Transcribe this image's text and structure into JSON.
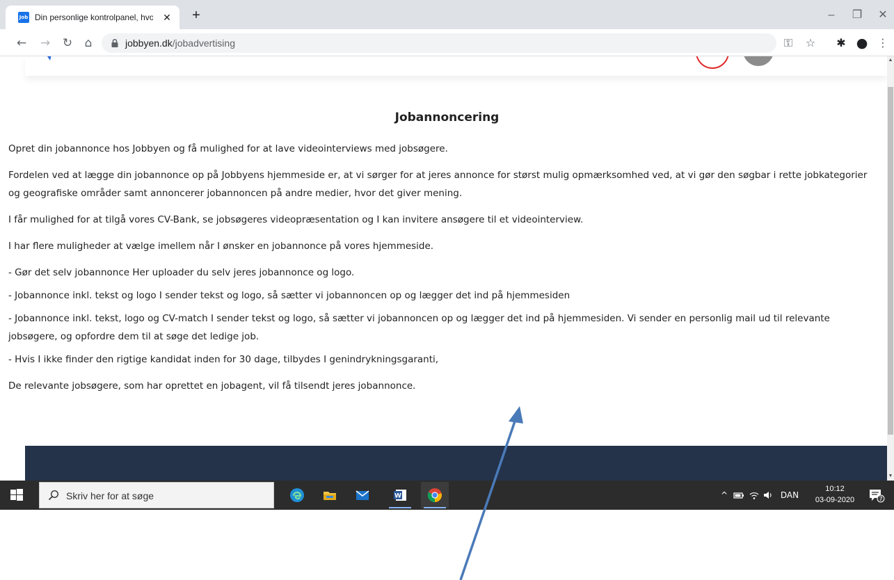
{
  "browser": {
    "tab": {
      "favicon_text": "Job",
      "title": "Din personlige kontrolpanel, hvo",
      "close_glyph": "✕"
    },
    "new_tab_glyph": "+",
    "window_controls": {
      "minimize": "–",
      "maximize": "❐",
      "close": "✕"
    },
    "toolbar": {
      "back_glyph": "←",
      "forward_glyph": "→",
      "reload_glyph": "↻",
      "home_glyph": "⌂",
      "url_host": "jobbyen.dk",
      "url_path": "/jobadvertising",
      "key_glyph": "⚿",
      "star_glyph": "☆",
      "extensions_glyph": "✱",
      "profile_glyph": "●",
      "menu_glyph": "⋮"
    }
  },
  "page": {
    "title": "Jobannoncering",
    "paragraphs": [
      "Opret din jobannonce hos Jobbyen og få mulighed for at lave videointerviews med jobsøgere.",
      "Fordelen ved at lægge din jobannonce op på Jobbyens hjemmeside er, at vi sørger for at jeres annonce for størst mulig opmærksomhed ved, at vi gør den søgbar i rette jobkategorier og geografiske områder samt annoncerer jobannoncen på andre medier, hvor det giver mening.",
      "I får mulighed for at tilgå vores CV-Bank, se jobsøgeres videopræsentation og I kan invitere ansøgere til et videointerview.",
      "I har flere muligheder at vælge imellem når I ønsker en jobannonce på vores hjemmeside."
    ],
    "options": [
      "- Gør det selv jobannonce Her uploader du selv jeres jobannonce og logo.",
      "- Jobannonce inkl. tekst og logo I sender tekst og logo, så sætter vi jobannoncen op og lægger det ind på hjemmesiden",
      "- Jobannonce inkl. tekst, logo og CV-match I sender tekst og logo, så sætter vi jobannoncen op og lægger det ind på hjemmesiden. Vi sender en personlig mail ud til relevante jobsøgere, og opfordre dem til at søge det ledige job.",
      "- Hvis I ikke finder den rigtige kandidat inden for 30 dage, tilbydes I genindrykningsgaranti,"
    ],
    "closing": "De relevante jobsøgere, som har oprettet en jobagent, vil få tilsendt jeres jobannonce."
  },
  "taskbar": {
    "search_placeholder": "Skriv her for at søge",
    "tray": {
      "chevron": "^",
      "language": "DAN",
      "time": "10:12",
      "date": "03-09-2020",
      "notification_count": "7"
    }
  },
  "colors": {
    "annotation_arrow": "#4a7ab8",
    "footer_bg": "#24324a",
    "taskbar_bg": "#2c2c2c"
  }
}
